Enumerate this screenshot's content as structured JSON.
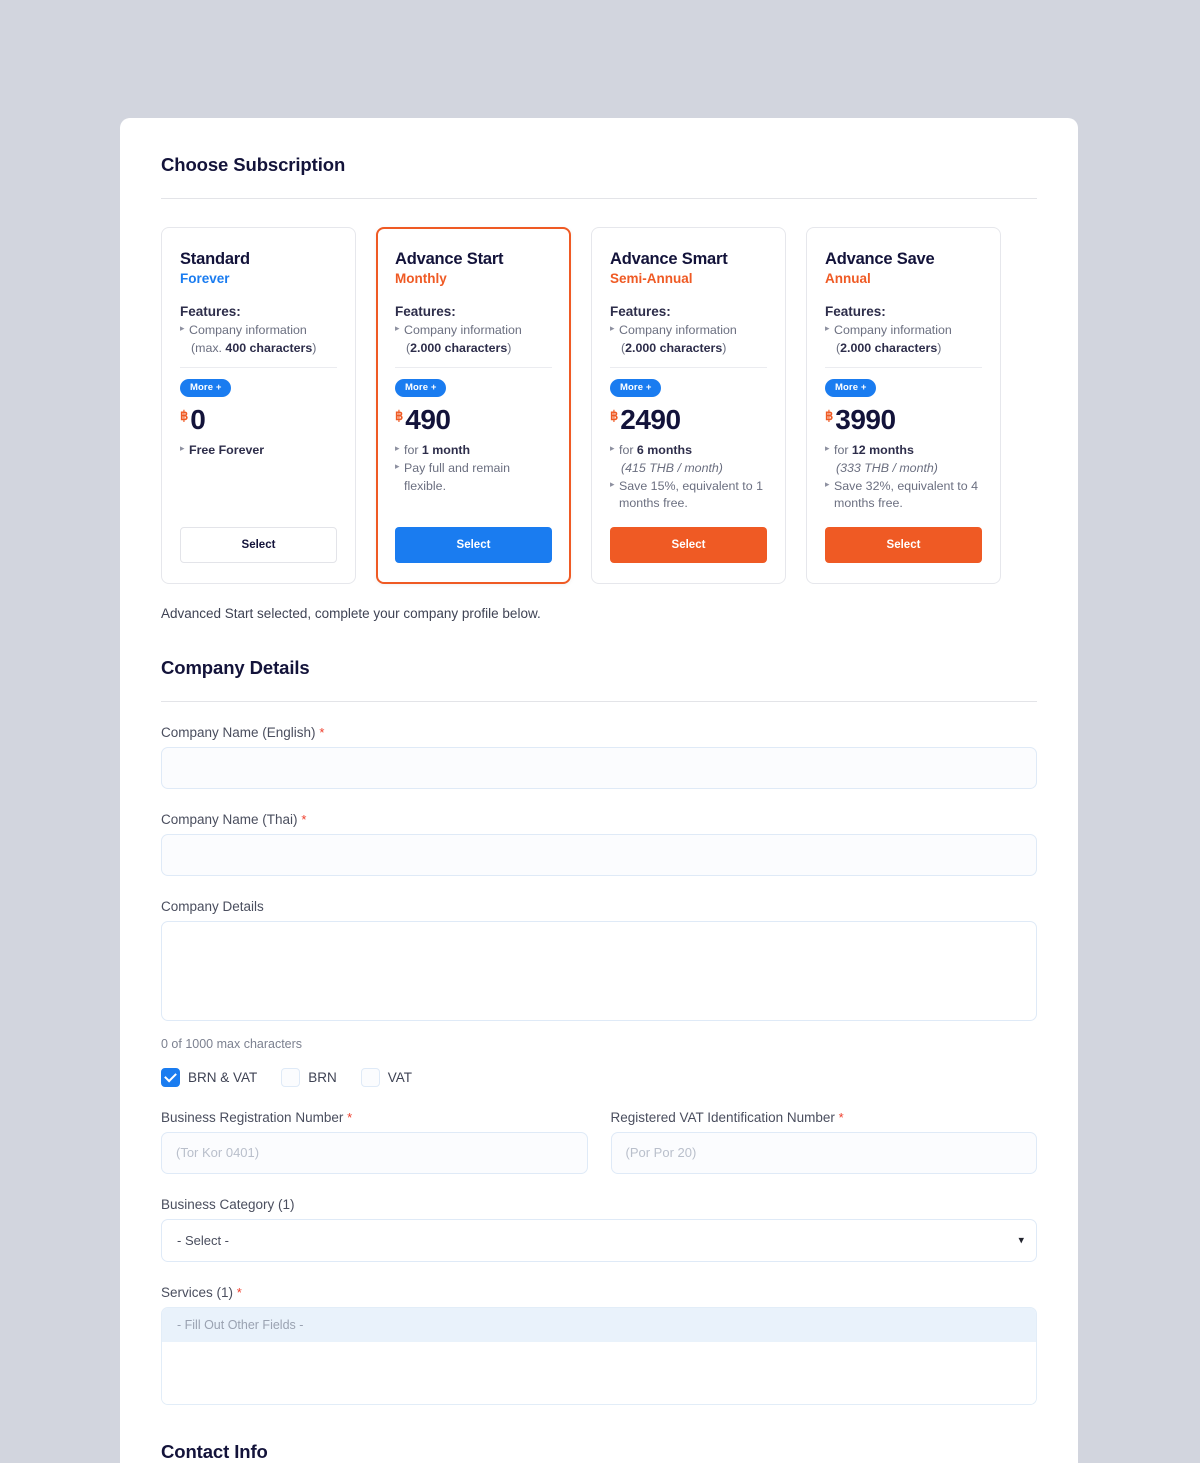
{
  "subscription": {
    "title": "Choose Subscription",
    "note": "Advanced Start selected, complete your company profile below.",
    "plans": [
      {
        "name": "Standard",
        "period": "Forever",
        "period_color": "#1a7cf0",
        "features_label": "Features:",
        "feature_main": "Company information",
        "feature_sub_prefix": "(max. ",
        "feature_sub_bold": "400 characters",
        "feature_sub_suffix": ")",
        "more_label": "More +",
        "currency": "฿",
        "price": "0",
        "note1_prefix": "",
        "note1_bold": "Free Forever",
        "note1_suffix": "",
        "note1_sub": "",
        "note2": "",
        "select_label": "Select",
        "button_style": "ghost",
        "selected": false
      },
      {
        "name": "Advance Start",
        "period": "Monthly",
        "period_color": "#ef5a24",
        "features_label": "Features:",
        "feature_main": "Company information",
        "feature_sub_prefix": "(",
        "feature_sub_bold": "2.000 characters",
        "feature_sub_suffix": ")",
        "more_label": "More +",
        "currency": "฿",
        "price": "490",
        "note1_prefix": "for ",
        "note1_bold": "1 month",
        "note1_suffix": "",
        "note1_sub": "",
        "note2": "Pay full and remain flexible.",
        "select_label": "Select",
        "button_style": "blue",
        "selected": true
      },
      {
        "name": "Advance Smart",
        "period": "Semi-Annual",
        "period_color": "#ef5a24",
        "features_label": "Features:",
        "feature_main": "Company information",
        "feature_sub_prefix": "(",
        "feature_sub_bold": "2.000 characters",
        "feature_sub_suffix": ")",
        "more_label": "More +",
        "currency": "฿",
        "price": "2490",
        "note1_prefix": "for ",
        "note1_bold": "6 months",
        "note1_suffix": "",
        "note1_sub": "(415 THB / month)",
        "note2": "Save 15%, equivalent to 1 months free.",
        "select_label": "Select",
        "button_style": "orange",
        "selected": false
      },
      {
        "name": "Advance Save",
        "period": "Annual",
        "period_color": "#ef5a24",
        "features_label": "Features:",
        "feature_main": "Company information",
        "feature_sub_prefix": "(",
        "feature_sub_bold": "2.000 characters",
        "feature_sub_suffix": ")",
        "more_label": "More +",
        "currency": "฿",
        "price": "3990",
        "note1_prefix": "for ",
        "note1_bold": "12 months",
        "note1_suffix": "",
        "note1_sub": "(333 THB / month)",
        "note2": "Save 32%, equivalent to 4 months free.",
        "select_label": "Select",
        "button_style": "orange",
        "selected": false
      }
    ]
  },
  "company_details": {
    "title": "Company Details",
    "company_name_en": {
      "label": "Company Name (English)",
      "required": "*",
      "value": "",
      "placeholder": ""
    },
    "company_name_th": {
      "label": "Company Name (Thai)",
      "required": "*",
      "value": "",
      "placeholder": ""
    },
    "company_details_field": {
      "label": "Company Details",
      "value": "",
      "placeholder": "",
      "char_count": "0 of 1000 max characters"
    },
    "doc_type_options": [
      {
        "label": "BRN & VAT",
        "checked": true
      },
      {
        "label": "BRN",
        "checked": false
      },
      {
        "label": "VAT",
        "checked": false
      }
    ],
    "brn": {
      "label": "Business Registration Number",
      "required": "*",
      "value": "",
      "placeholder": "(Tor Kor 0401)"
    },
    "vat": {
      "label": "Registered VAT Identification Number",
      "required": "*",
      "value": "",
      "placeholder": "(Por Por 20)"
    },
    "business_category": {
      "label": "Business Category (1)",
      "selected": "- Select -",
      "options": [
        "- Select -"
      ]
    },
    "services": {
      "label": "Services (1)",
      "required": "*",
      "header": "- Fill Out Other Fields -"
    }
  },
  "contact_info": {
    "title": "Contact Info"
  },
  "colors": {
    "accent_blue": "#1a7cf0",
    "accent_orange": "#ef5a24",
    "required_red": "#ef3d2b",
    "page_bg": "#d2d5de",
    "heading": "#13133a"
  }
}
